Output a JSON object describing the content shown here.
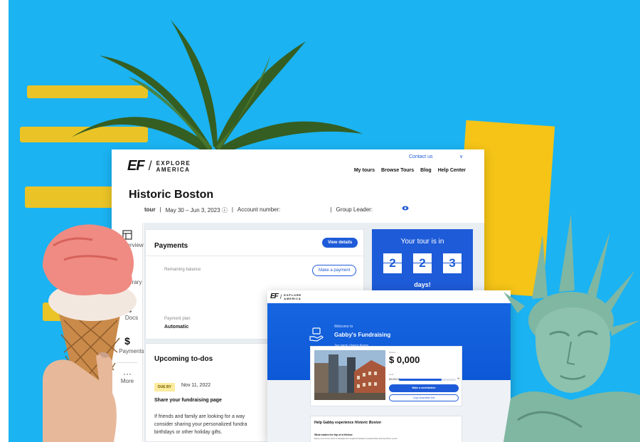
{
  "brand": {
    "logo_ef": "EF",
    "logo_slash": "/",
    "logo_sub": "EXPLORE AMERICA",
    "blue": "#1e5bd8",
    "background_blue": "#1bb3f2",
    "yellow": "#f5c417"
  },
  "header": {
    "contact": "Contact us",
    "nav": [
      "My tours",
      "Browse Tours",
      "Blog",
      "Help Center"
    ]
  },
  "tour": {
    "title": "Historic Boston",
    "type_label": "tour",
    "separator": "|",
    "dates": "May 30 – Jun 3, 2023",
    "account_label": "Account number:",
    "group_leader_label": "Group Leader:"
  },
  "sidebar": {
    "items": [
      {
        "label": "Overview",
        "icon": "layout-icon"
      },
      {
        "label": "Itinerary",
        "icon": "itinerary-icon"
      },
      {
        "label": "Docs",
        "icon": "docs-icon"
      },
      {
        "label": "Payments",
        "icon": "dollar-icon"
      },
      {
        "label": "More",
        "icon": "more-icon"
      }
    ],
    "more_dots": "···",
    "dollar_glyph": "$"
  },
  "payments": {
    "title": "Payments",
    "view_details": "View details",
    "remaining_label": "Remaining balance",
    "make_payment": "Make a payment",
    "plan_label": "Payment plan",
    "plan_value": "Automatic"
  },
  "countdown": {
    "title": "Your tour is in",
    "digits": [
      "2",
      "2",
      "3"
    ],
    "unit": "days!"
  },
  "todos": {
    "title": "Upcoming to-dos",
    "due_label": "DUE BY",
    "due_date": "Nov 11, 2022",
    "item_title": "Share your fundraising page",
    "item_lines": [
      "If friends and family are looking for a way",
      "consider sharing your personalized fundra",
      "birthdays or other holiday gifts."
    ]
  },
  "fundraising": {
    "welcome": "Welcome to",
    "name": "Gabby's Fundraising",
    "tour_name_label": "Tour name:",
    "tour_name": "Historic Boston",
    "raised_label": "Raised",
    "amount": "$ 0,000",
    "goal_label": "Goal",
    "goal_value": "$5,000.00",
    "progress": 0.75,
    "percent": "%",
    "make_contribution": "Make a contribution",
    "copy_link": "Copy shareable link",
    "help_prefix": "Help Gabby experience",
    "help_tour": "Historic Boston",
    "help_sub": "What makes the trip of a lifetime",
    "help_body": "Every one of our tours is designed to expand travelers' perspectives and set them up for"
  }
}
